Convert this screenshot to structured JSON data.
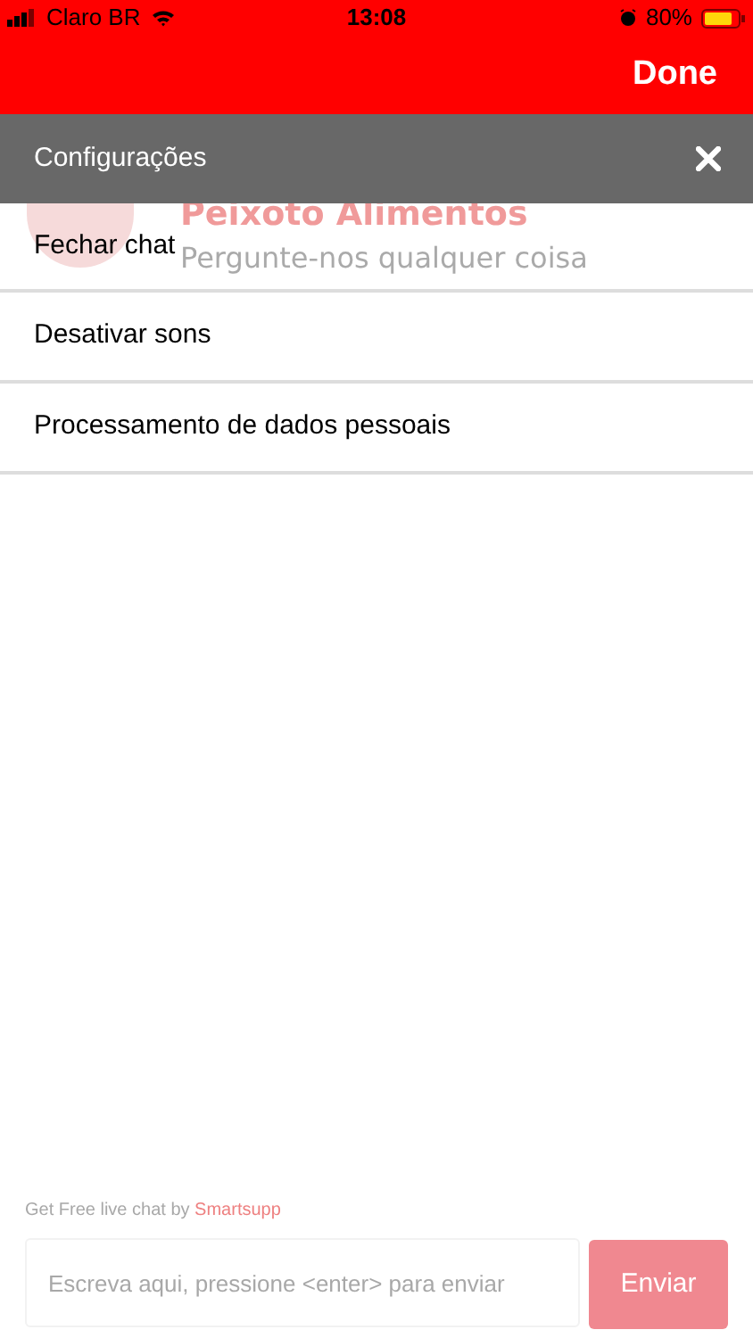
{
  "status_bar": {
    "carrier": "Claro BR",
    "time": "13:08",
    "battery": "80%"
  },
  "nav_bar": {
    "done": "Done"
  },
  "chat": {
    "title": "Peixoto Alimentos",
    "subtitle": "Pergunte-nos qualquer coisa",
    "footer_text": "Get Free live chat by",
    "footer_link": "Smartsupp",
    "input": {
      "placeholder": "Escreva aqui, pressione <enter> para enviar"
    },
    "send_button": "Enviar"
  },
  "settings": {
    "title": "Configurações",
    "items": [
      {
        "label": "Fechar chat"
      },
      {
        "label": "Desativar sons"
      },
      {
        "label": "Processamento de dados pessoais"
      }
    ]
  }
}
